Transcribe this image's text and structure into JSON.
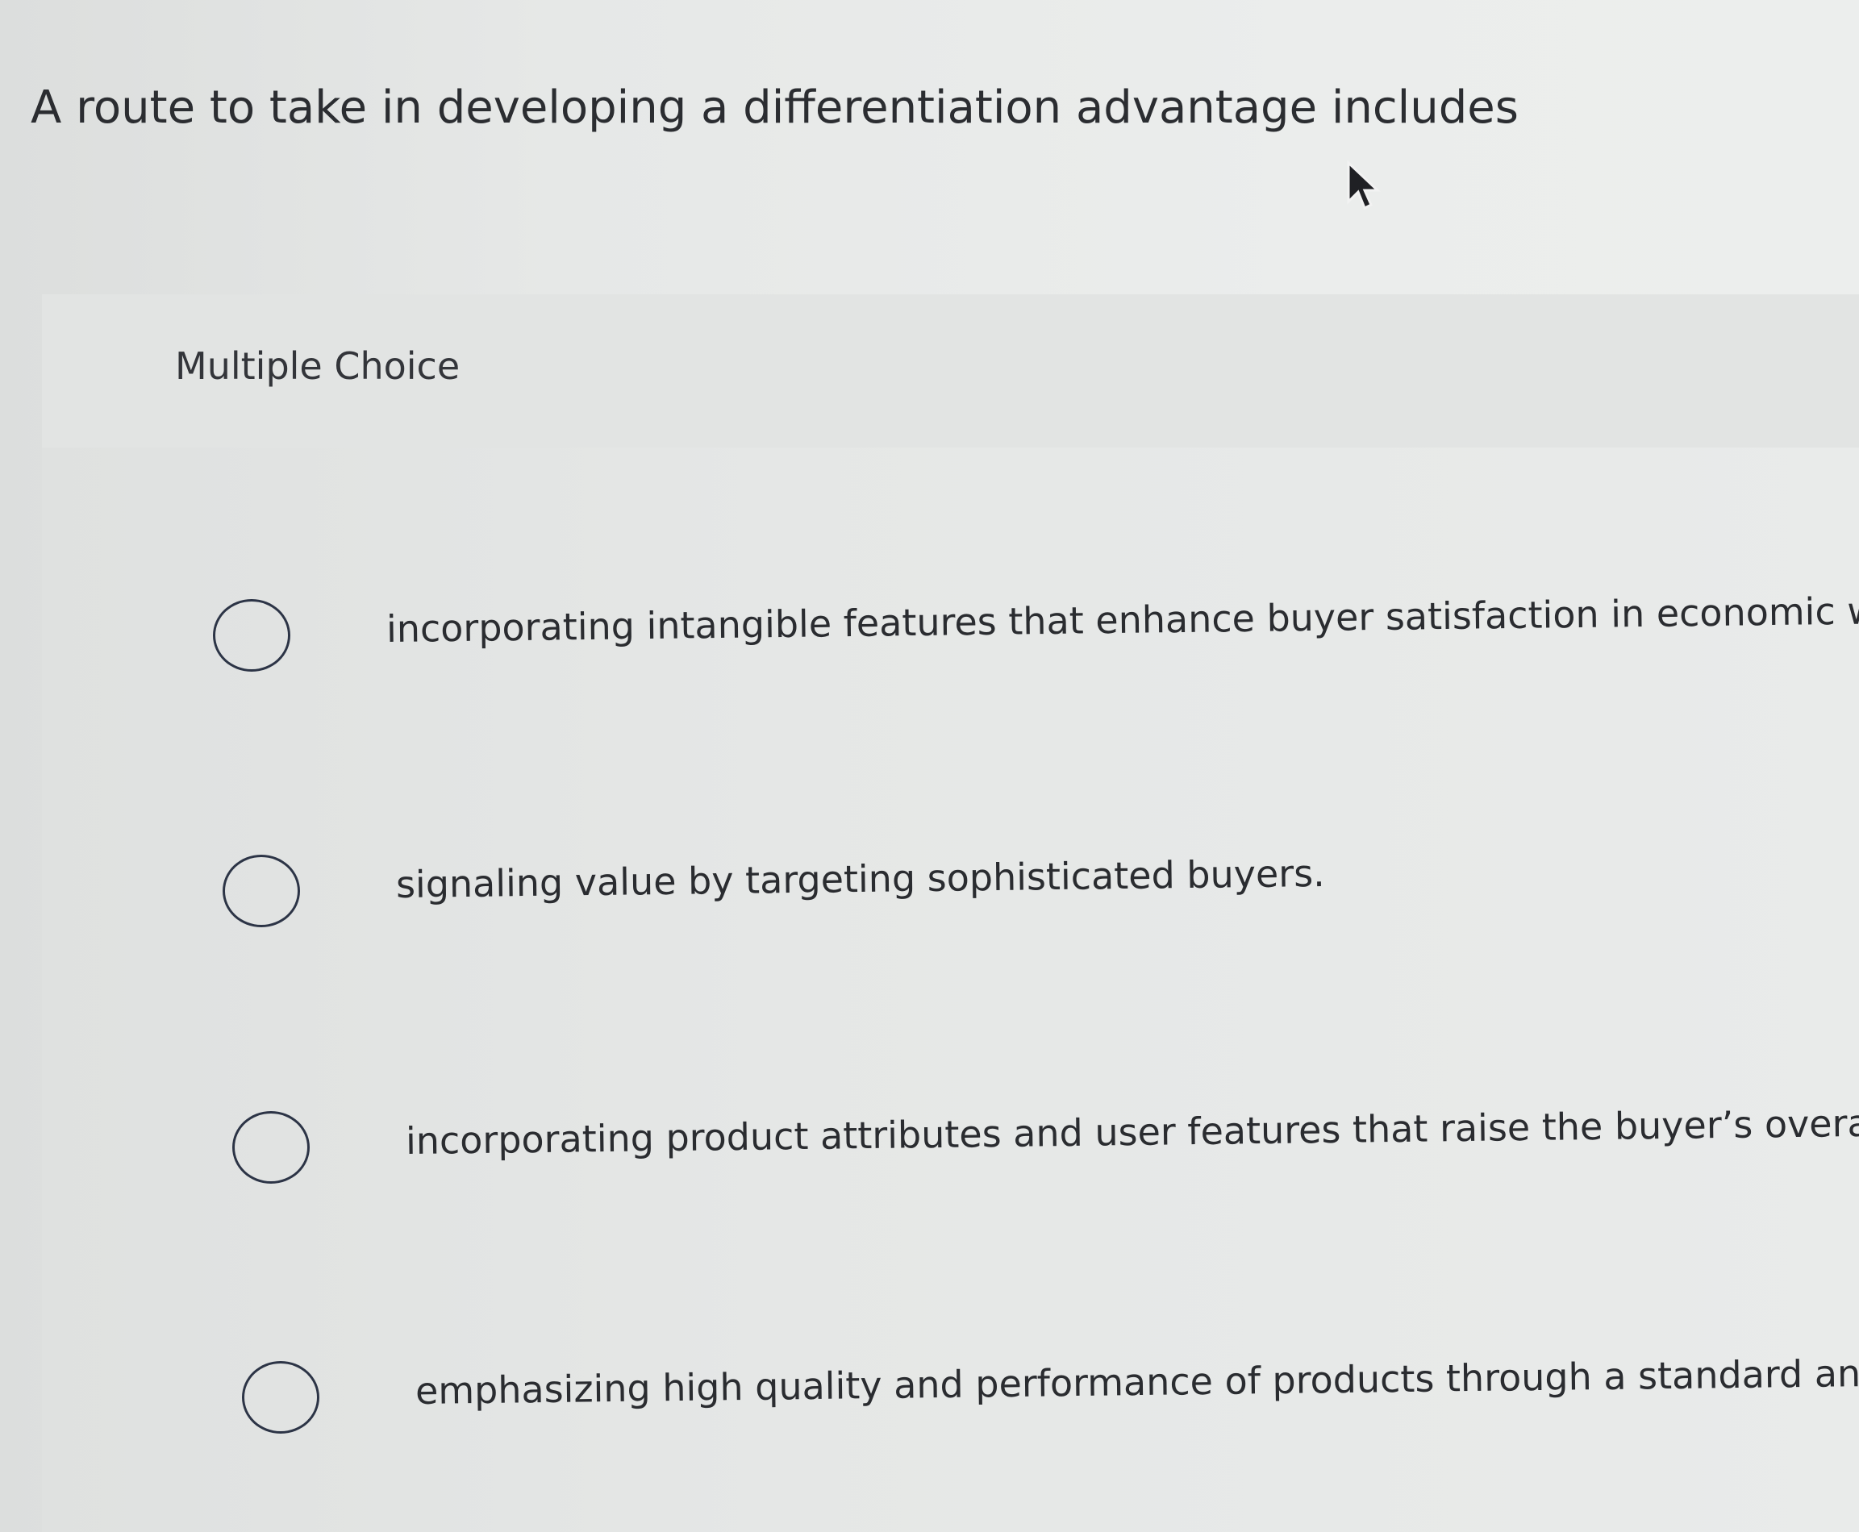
{
  "question": {
    "text": "A route to take in developing a differentiation advantage includes"
  },
  "multiple_choice": {
    "label": "Multiple Choice",
    "options": [
      {
        "text": "incorporating intangible features that enhance buyer satisfaction in economic ways."
      },
      {
        "text": "signaling value by targeting sophisticated buyers."
      },
      {
        "text": "incorporating product attributes and user features that raise the buyer’s overall costs, but l"
      },
      {
        "text": "emphasizing high quality and performance of products through a standard and simple, no-f"
      }
    ]
  },
  "icons": {
    "cursor": "mouse-pointer-icon",
    "radio": "radio-button-icon"
  },
  "colors": {
    "background": "#e6e8e7",
    "text": "#2a2c30",
    "radio_border": "#2c3446"
  }
}
